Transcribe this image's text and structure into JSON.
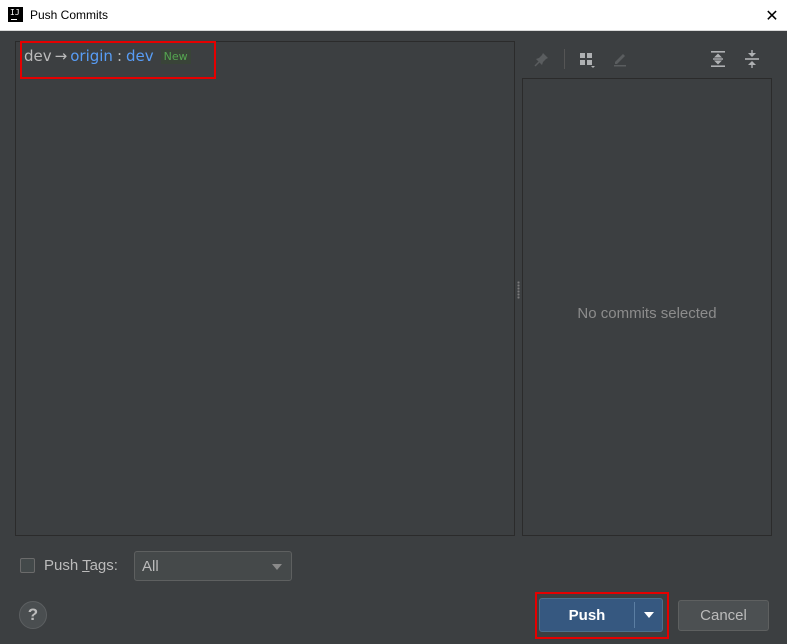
{
  "window": {
    "title": "Push Commits",
    "app_icon_glyph": "IJ",
    "close_glyph": "✕"
  },
  "push_spec": {
    "local_branch": "dev",
    "arrow": "→",
    "remote": "origin",
    "separator": ":",
    "remote_branch": "dev",
    "badge": "New"
  },
  "details": {
    "empty_text": "No commits selected"
  },
  "toolbar": {
    "icons": [
      "pin-icon",
      "group-by-icon",
      "edit-icon",
      "expand-all-icon",
      "collapse-all-icon"
    ]
  },
  "tags": {
    "checkbox_checked": false,
    "label_prefix": "Push ",
    "label_mnemonic": "T",
    "label_suffix": "ags:",
    "selected": "All"
  },
  "footer": {
    "help_glyph": "?",
    "push_label": "Push",
    "cancel_label": "Cancel"
  },
  "colors": {
    "background": "#3c3f41",
    "link": "#589df6",
    "badge_text": "#55a651",
    "primary_button": "#365880",
    "highlight": "#e50000"
  }
}
